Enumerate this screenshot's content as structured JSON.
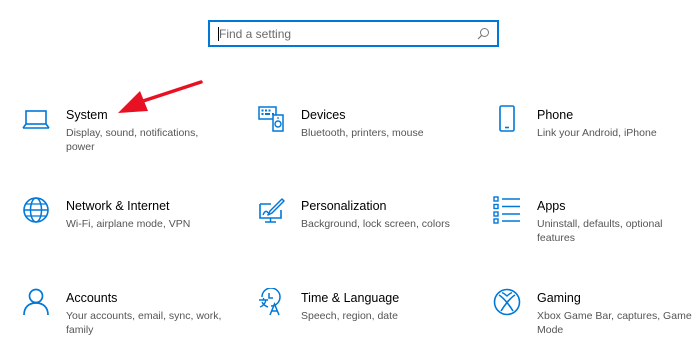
{
  "search": {
    "placeholder": "Find a setting"
  },
  "accent_color": "#0078d7",
  "annotation_color": "#e81123",
  "tiles": [
    {
      "icon": "laptop-icon",
      "title": "System",
      "desc": "Display, sound, notifications, power"
    },
    {
      "icon": "devices-icon",
      "title": "Devices",
      "desc": "Bluetooth, printers, mouse"
    },
    {
      "icon": "phone-icon",
      "title": "Phone",
      "desc": "Link your Android, iPhone"
    },
    {
      "icon": "globe-icon",
      "title": "Network & Internet",
      "desc": "Wi-Fi, airplane mode, VPN"
    },
    {
      "icon": "personalization-icon",
      "title": "Personalization",
      "desc": "Background, lock screen, colors"
    },
    {
      "icon": "apps-icon",
      "title": "Apps",
      "desc": "Uninstall, defaults, optional features"
    },
    {
      "icon": "person-icon",
      "title": "Accounts",
      "desc": "Your accounts, email, sync, work, family"
    },
    {
      "icon": "time-language-icon",
      "title": "Time & Language",
      "desc": "Speech, region, date"
    },
    {
      "icon": "xbox-icon",
      "title": "Gaming",
      "desc": "Xbox Game Bar, captures, Game Mode"
    }
  ]
}
